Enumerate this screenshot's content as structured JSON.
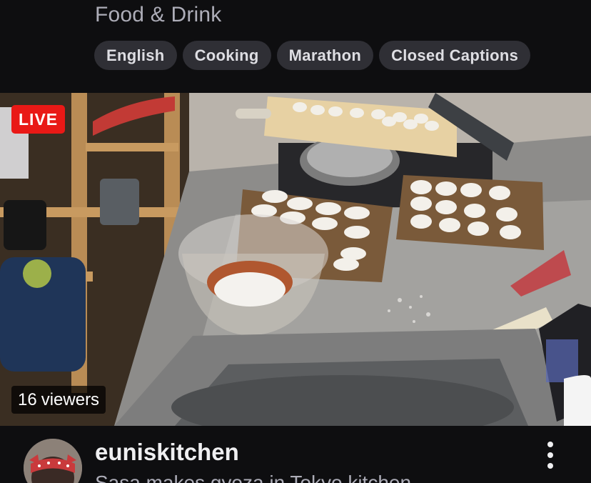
{
  "category": "Food & Drink",
  "tags": [
    "English",
    "Cooking",
    "Marathon",
    "Closed Captions"
  ],
  "video": {
    "live_label": "LIVE",
    "viewer_count": "16",
    "viewer_label": "viewers"
  },
  "channel": {
    "name": "euniskitchen",
    "title": "Sasa makes gyoza in Tokyo kitchen"
  },
  "colors": {
    "background": "#0e0e10",
    "tag_bg": "#2f2f35",
    "live_red": "#e91916",
    "muted_text": "#adadb8"
  },
  "icons": {
    "more": "more-vertical-icon"
  }
}
